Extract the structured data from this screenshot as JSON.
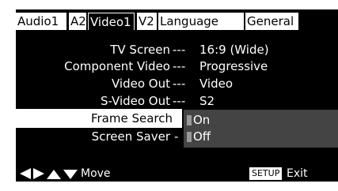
{
  "tabs": [
    {
      "label": "Audio1",
      "active": false
    },
    {
      "label": "A2",
      "active": false
    },
    {
      "label": "Video1",
      "active": true
    },
    {
      "label": "V2",
      "active": false
    },
    {
      "label": "Language",
      "active": false
    },
    {
      "label": "General",
      "active": false
    }
  ],
  "settings": [
    {
      "label": "TV Screen",
      "separator": "---",
      "value": "16:9 (Wide)"
    },
    {
      "label": "Component Video",
      "separator": "---",
      "value": "Progressive"
    },
    {
      "label": "Video Out",
      "separator": "---",
      "value": "Video"
    },
    {
      "label": "S-Video Out",
      "separator": "---",
      "value": "S2"
    },
    {
      "label": "Frame Search",
      "separator": "",
      "value": ""
    },
    {
      "label": "Screen Saver",
      "separator": "-",
      "value": ""
    }
  ],
  "popup": {
    "options": [
      {
        "label": "On",
        "highlighted": true
      },
      {
        "label": "Off",
        "highlighted": false
      }
    ]
  },
  "footer": {
    "move_label": "Move",
    "setup_label": "SETUP",
    "exit_label": "Exit",
    "arrow_icons": [
      "left-arrow-icon",
      "right-arrow-icon",
      "up-arrow-icon",
      "down-arrow-icon"
    ]
  },
  "colors": {
    "background": "#000000",
    "foreground": "#ffffff",
    "popup": "#444444"
  }
}
